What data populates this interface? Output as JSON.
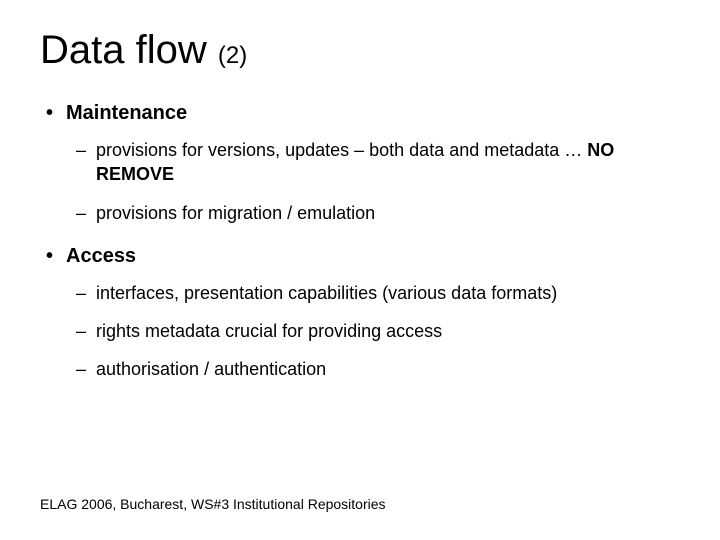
{
  "title_main": "Data flow ",
  "title_sub": "(2)",
  "sections": [
    {
      "header": "Maintenance",
      "items": [
        {
          "text": "provisions for versions, updates – both data and metadata … ",
          "bold_suffix": "NO REMOVE"
        },
        {
          "text": "provisions for migration / emulation"
        }
      ]
    },
    {
      "header": "Access",
      "items": [
        {
          "text": "interfaces, presentation capabilities (various data formats)"
        },
        {
          "text": "rights metadata crucial for providing access"
        },
        {
          "text": "authorisation / authentication"
        }
      ]
    }
  ],
  "footer": "ELAG 2006, Bucharest, WS#3  Institutional Repositories"
}
